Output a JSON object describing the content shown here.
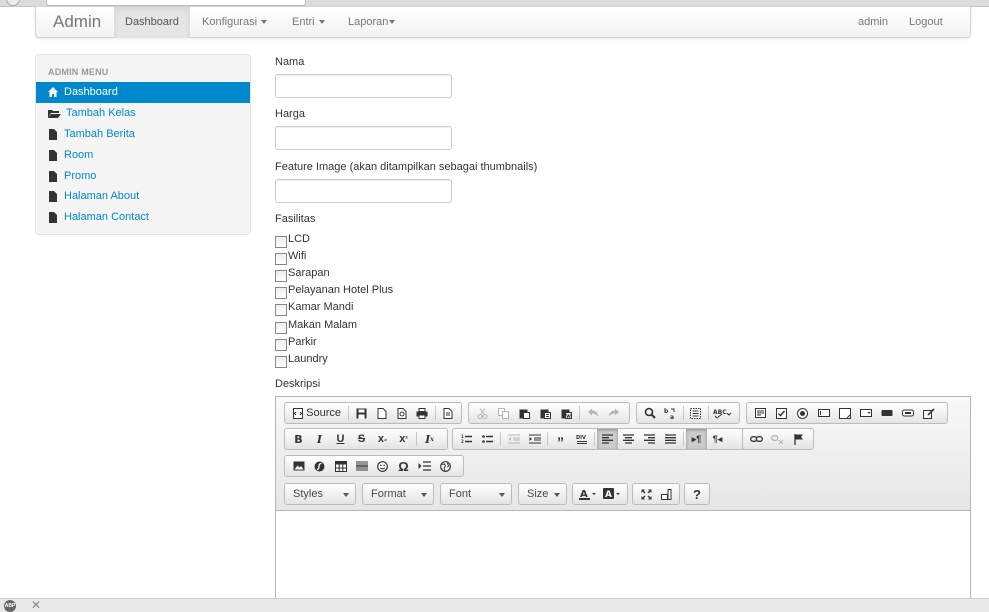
{
  "navbar": {
    "brand": "Admin",
    "items": [
      {
        "label": "Dashboard",
        "active": true,
        "dropdown": false
      },
      {
        "label": "Konfigurasi",
        "active": false,
        "dropdown": true
      },
      {
        "label": "Entri",
        "active": false,
        "dropdown": true
      },
      {
        "label": "Laporan",
        "active": false,
        "dropdown": true
      }
    ],
    "user": "admin",
    "logout": "Logout"
  },
  "sidebar": {
    "header": "ADMIN MENU",
    "items": [
      {
        "label": "Dashboard",
        "icon": "home-icon",
        "active": true
      },
      {
        "label": "Tambah Kelas",
        "icon": "folder-open-icon",
        "active": false
      },
      {
        "label": "Tambah Berita",
        "icon": "file-icon",
        "active": false
      },
      {
        "label": "Room",
        "icon": "file-icon",
        "active": false
      },
      {
        "label": "Promo",
        "icon": "file-icon",
        "active": false
      },
      {
        "label": "Halaman About",
        "icon": "file-icon",
        "active": false
      },
      {
        "label": "Halaman Contact",
        "icon": "file-icon",
        "active": false
      }
    ]
  },
  "form": {
    "nama": {
      "label": "Nama",
      "value": ""
    },
    "harga": {
      "label": "Harga",
      "value": ""
    },
    "feature_image": {
      "label": "Feature Image (akan ditampilkan sebagai thumbnails)",
      "value": ""
    },
    "fasilitas": {
      "label": "Fasilitas",
      "options": [
        "LCD",
        "Wifi",
        "Sarapan",
        "Pelayanan Hotel Plus",
        "Kamar Mandi",
        "Makan Malam",
        "Parkir",
        "Laundry"
      ]
    },
    "deskripsi": {
      "label": "Deskripsi",
      "source_label": "Source",
      "styles_label": "Styles",
      "format_label": "Format",
      "font_label": "Font",
      "size_label": "Size",
      "help_label": "?"
    }
  },
  "colors": {
    "accent": "#0088cc",
    "navbar_bg": "#f2f2f2",
    "sidebar_bg": "#f5f5f5"
  }
}
